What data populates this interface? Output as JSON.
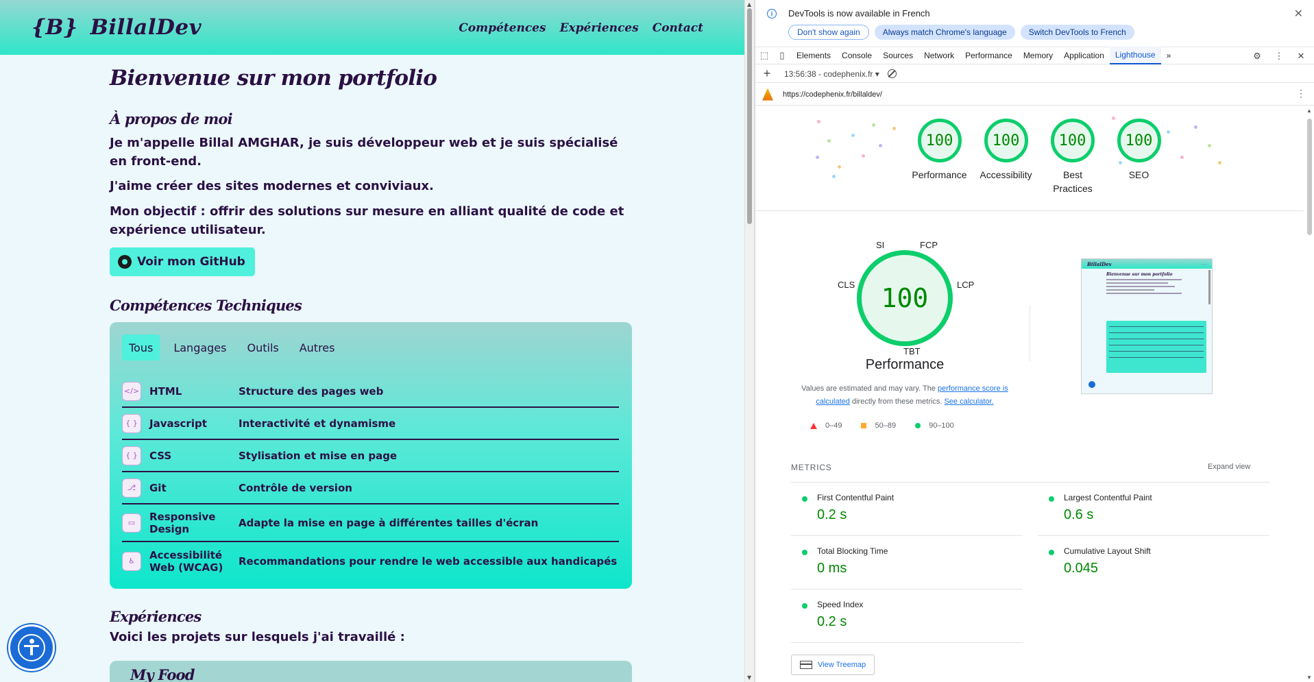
{
  "site": {
    "logo_brace": "{B}",
    "logo_name": "BillalDev",
    "nav": [
      "Compétences",
      "Expériences",
      "Contact"
    ],
    "title": "Bienvenue sur mon portfolio",
    "about_title": "À propos de moi",
    "about_paragraphs": [
      "Je m'appelle Billal AMGHAR, je suis développeur web et je suis spécialisé en front-end.",
      "J'aime créer des sites modernes et conviviaux.",
      "Mon objectif : offrir des solutions sur mesure en alliant qualité de code et expérience utilisateur."
    ],
    "github_button": "Voir mon GitHub",
    "skills_title": "Compétences Techniques",
    "skill_tabs": [
      "Tous",
      "Langages",
      "Outils",
      "Autres"
    ],
    "skills": [
      {
        "name": "HTML",
        "desc": "Structure des pages web",
        "icon": "html-icon"
      },
      {
        "name": "Javascript",
        "desc": "Interactivité et dynamisme",
        "icon": "javascript-icon"
      },
      {
        "name": "CSS",
        "desc": "Stylisation et mise en page",
        "icon": "css-icon"
      },
      {
        "name": "Git",
        "desc": "Contrôle de version",
        "icon": "git-icon"
      },
      {
        "name": "Responsive Design",
        "desc": "Adapte la mise en page à différentes tailles d'écran",
        "icon": "responsive-icon"
      },
      {
        "name": "Accessibilité Web (WCAG)",
        "desc": "Recommandations pour rendre le web accessible aux handicapés",
        "icon": "accessibility-icon"
      }
    ],
    "experiences_title": "Expériences",
    "experiences_intro": "Voici les projets sur lesquels j'ai travaillé :",
    "project_title": "My Food",
    "colors": {
      "header": "#2ee6c8",
      "text": "#2b1044",
      "accent": "#4ff0dc"
    }
  },
  "devtools": {
    "info_text": "DevTools is now available in French",
    "info_buttons": [
      "Don't show again",
      "Always match Chrome's language",
      "Switch DevTools to French"
    ],
    "tabs": [
      "Elements",
      "Console",
      "Sources",
      "Network",
      "Performance",
      "Memory",
      "Application",
      "Lighthouse"
    ],
    "active_tab": "Lighthouse",
    "more_tabs": "»",
    "report_select": "13:56:38 - codephenix.fr ▾",
    "url": "https://codephenix.fr/billaldev/",
    "scores": [
      {
        "label": "Performance",
        "value": "100"
      },
      {
        "label": "Accessibility",
        "value": "100"
      },
      {
        "label": "Best Practices",
        "value": "100"
      },
      {
        "label": "SEO",
        "value": "100"
      }
    ],
    "perf_score": "100",
    "perf_title": "Performance",
    "gauge_labels": {
      "si": "SI",
      "fcp": "FCP",
      "cls": "CLS",
      "lcp": "LCP",
      "tbt": "TBT"
    },
    "note": {
      "text1": "Values are estimated and may vary. The ",
      "link1": "performance score is calculated",
      "text2": " directly from these metrics. ",
      "link2": "See calculator."
    },
    "legend": [
      "0–49",
      "50–89",
      "90–100"
    ],
    "metrics_header": "METRICS",
    "expand_view": "Expand view",
    "metrics": [
      {
        "name": "First Contentful Paint",
        "value": "0.2 s"
      },
      {
        "name": "Largest Contentful Paint",
        "value": "0.6 s"
      },
      {
        "name": "Total Blocking Time",
        "value": "0 ms"
      },
      {
        "name": "Cumulative Layout Shift",
        "value": "0.045"
      },
      {
        "name": "Speed Index",
        "value": "0.2 s"
      }
    ],
    "treemap_button": "View Treemap",
    "colors": {
      "pass": "#0cce6b",
      "average": "#ffaa33",
      "fail": "#ff3333",
      "link": "#1a73e8"
    }
  }
}
